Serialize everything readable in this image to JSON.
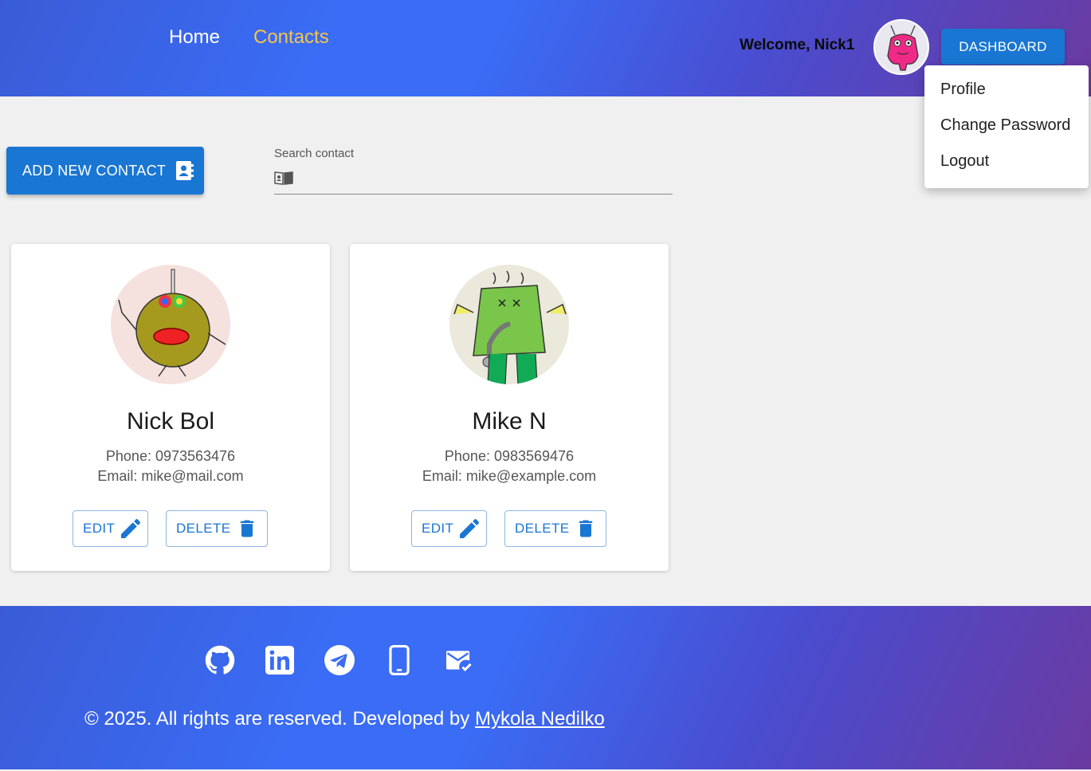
{
  "header": {
    "nav": [
      {
        "label": "Home"
      },
      {
        "label": "Contacts"
      }
    ],
    "welcome": "Welcome, Nick1",
    "dashboard_label": "DASHBOARD",
    "user_menu": [
      {
        "label": "Profile"
      },
      {
        "label": "Change Password"
      },
      {
        "label": "Logout"
      }
    ]
  },
  "toolbar": {
    "add_label": "ADD NEW CONTACT",
    "search_label": "Search contact",
    "search_value": ""
  },
  "contacts": [
    {
      "name": "Nick Bol",
      "phone": "Phone: 0973563476",
      "email": "Email: mike@mail.com",
      "edit_label": "EDIT",
      "delete_label": "DELETE"
    },
    {
      "name": "Mike N",
      "phone": "Phone: 0983569476",
      "email": "Email: mike@example.com",
      "edit_label": "EDIT",
      "delete_label": "DELETE"
    }
  ],
  "footer": {
    "social_icons": [
      "github-icon",
      "linkedin-icon",
      "telegram-icon",
      "phone-icon",
      "email-icon"
    ],
    "copyright_text": "© 2025. All rights are reserved. Developed by ",
    "developer_name": "Mykola Nedilko"
  },
  "colors": {
    "primary": "#1976d2",
    "active_nav": "#f3c64a",
    "gradient_start": "#3a6cf5",
    "gradient_end": "#6a3aa0"
  }
}
